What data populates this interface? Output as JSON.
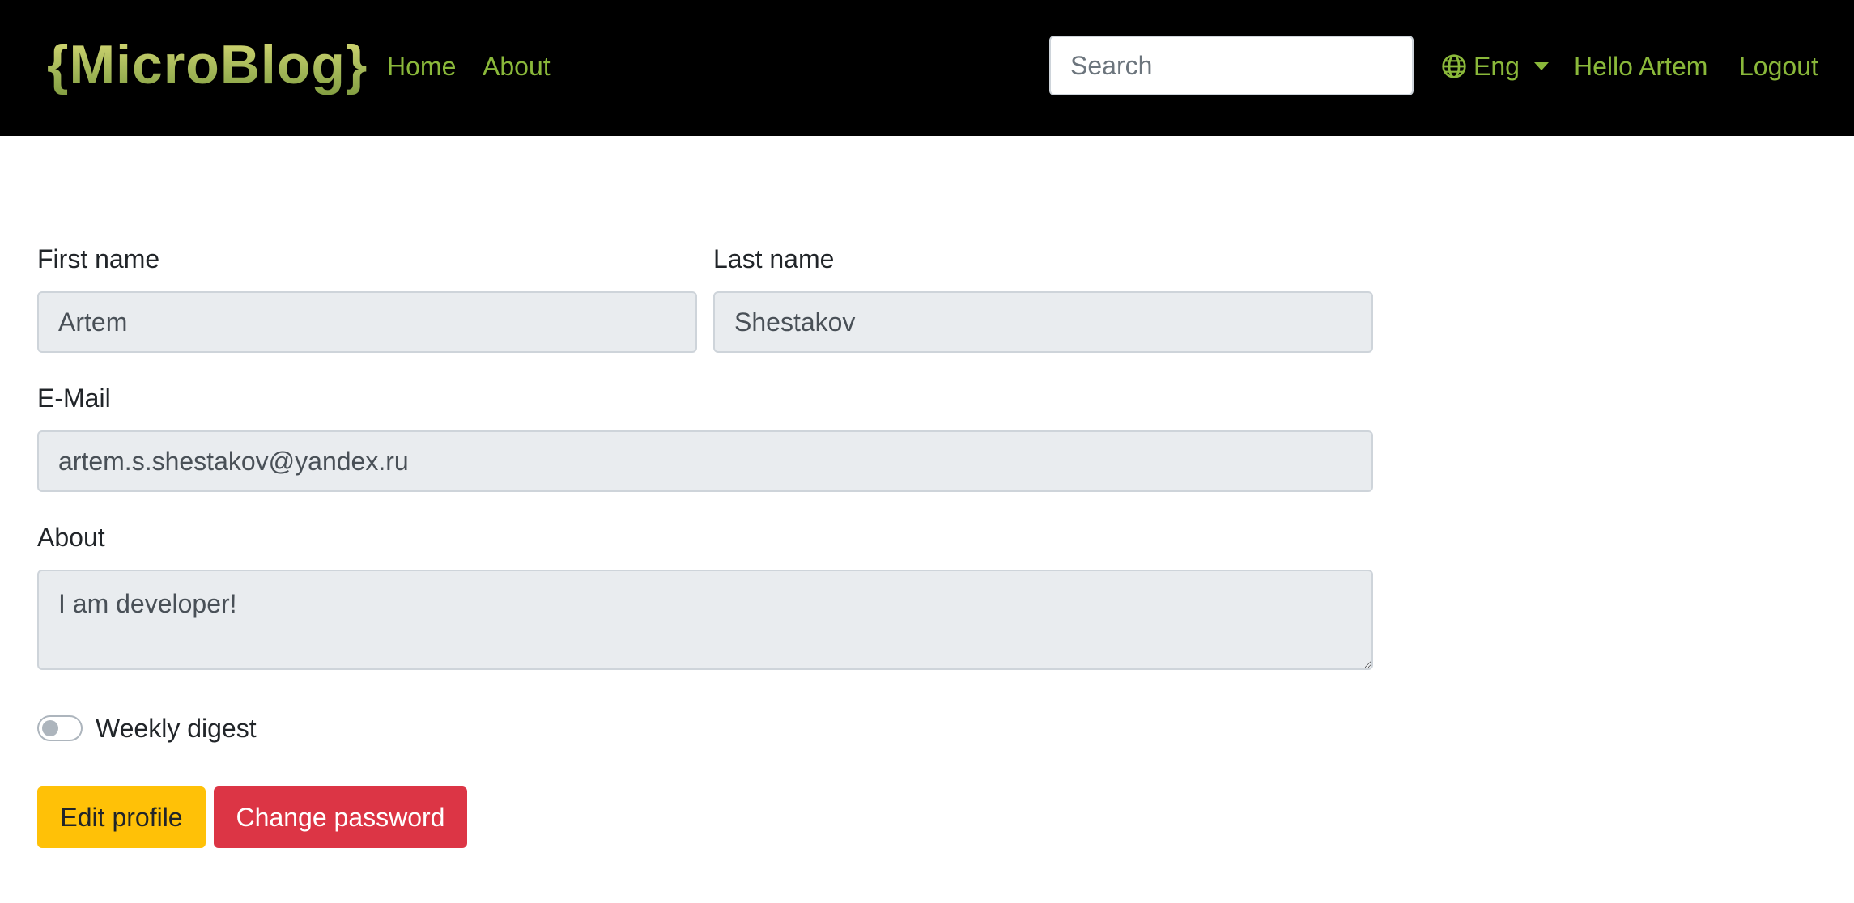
{
  "navbar": {
    "brand": "{MicroBlog}",
    "links": [
      {
        "label": "Home"
      },
      {
        "label": "About"
      }
    ],
    "search_placeholder": "Search",
    "language": {
      "label": "Eng",
      "icon": "globe-icon"
    },
    "greeting": "Hello Artem",
    "logout": "Logout",
    "colors": {
      "background": "#000000",
      "link": "#8ab83a"
    }
  },
  "form": {
    "first_name": {
      "label": "First name",
      "value": "Artem"
    },
    "last_name": {
      "label": "Last name",
      "value": "Shestakov"
    },
    "email": {
      "label": "E-Mail",
      "value": "artem.s.shestakov@yandex.ru"
    },
    "about": {
      "label": "About",
      "value": "I am developer!"
    },
    "weekly_digest": {
      "label": "Weekly digest",
      "checked": false
    },
    "readonly": true
  },
  "actions": {
    "edit_profile": "Edit profile",
    "change_password": "Change password",
    "colors": {
      "edit": "#ffc107",
      "change_password": "#dc3545"
    }
  }
}
